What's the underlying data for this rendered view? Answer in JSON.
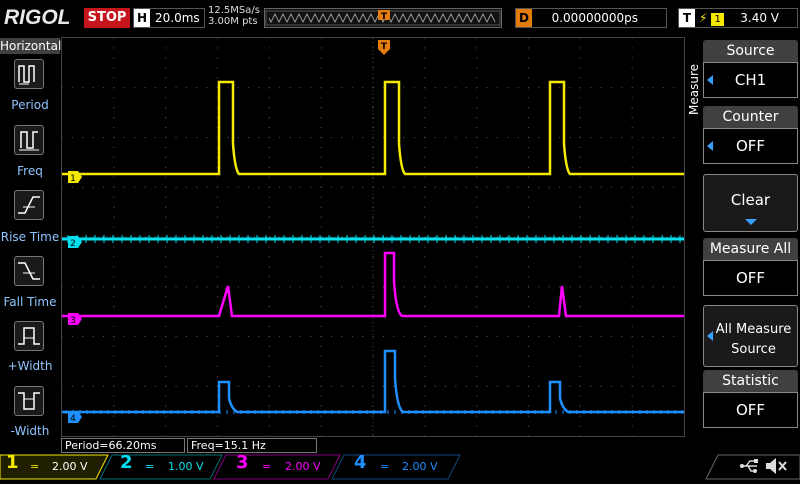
{
  "topbar": {
    "brand": "RIGOL",
    "run_state": "STOP",
    "timebase_label": "H",
    "timebase_value": "20.0ms",
    "sample_rate": "12.5MSa/s",
    "memory_depth": "3.00M pts",
    "trigger_marker": "T",
    "delay_label": "D",
    "delay_value": "0.00000000ps",
    "trigger_label": "T",
    "trigger_source": "1",
    "trigger_level": "3.40 V"
  },
  "left_menu": {
    "title": "Horizontal",
    "items": [
      {
        "label": "Period",
        "icon": "period-icon"
      },
      {
        "label": "Freq",
        "icon": "freq-icon"
      },
      {
        "label": "Rise Time",
        "icon": "rise-time-icon"
      },
      {
        "label": "Fall Time",
        "icon": "fall-time-icon"
      },
      {
        "label": "+Width",
        "icon": "pos-width-icon"
      },
      {
        "label": "-Width",
        "icon": "neg-width-icon"
      }
    ]
  },
  "right_menu": {
    "tab": "Measure",
    "items": [
      {
        "title": "Source",
        "value": "CH1",
        "arrow": true
      },
      {
        "title": "Counter",
        "value": "OFF",
        "arrow": true
      },
      {
        "title": "",
        "value": "Clear",
        "arrow": false
      },
      {
        "title": "Measure All",
        "value": "OFF",
        "arrow": false
      },
      {
        "title": "",
        "value": "All Measure Source",
        "arrow": true
      },
      {
        "title": "Statistic",
        "value": "OFF",
        "arrow": false
      }
    ]
  },
  "measurements": [
    {
      "text": "Period=66.20ms"
    },
    {
      "text": "Freq=15.1 Hz"
    }
  ],
  "channels": [
    {
      "num": "1",
      "coupling": "=",
      "scale": "2.00 V",
      "color": "#f5e900"
    },
    {
      "num": "2",
      "coupling": "=",
      "scale": "1.00 V",
      "color": "#00e0f0"
    },
    {
      "num": "3",
      "coupling": "=",
      "scale": "2.00 V",
      "color": "#ff00ff"
    },
    {
      "num": "4",
      "coupling": "=",
      "scale": "2.00 V",
      "color": "#1e90ff"
    }
  ],
  "colors": {
    "ch1": "#f5e900",
    "ch2": "#00e0f0",
    "ch3": "#ff00ff",
    "ch4": "#1e90ff",
    "stop": "#c4161c",
    "trigger": "#e57c0a"
  }
}
